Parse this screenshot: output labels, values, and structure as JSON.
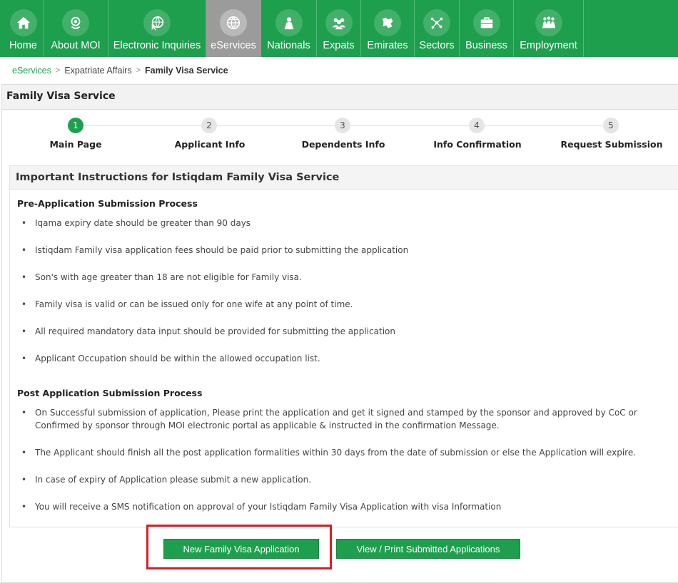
{
  "nav": {
    "items": [
      {
        "label": "Home",
        "icon": "home-icon"
      },
      {
        "label": "About MOI",
        "icon": "emblem-icon"
      },
      {
        "label": "Electronic Inquiries",
        "icon": "globe-cursor-icon"
      },
      {
        "label": "eServices",
        "icon": "globe-icon",
        "active": true
      },
      {
        "label": "Nationals",
        "icon": "person-icon"
      },
      {
        "label": "Expats",
        "icon": "group-icon"
      },
      {
        "label": "Emirates",
        "icon": "map-icon"
      },
      {
        "label": "Sectors",
        "icon": "network-icon"
      },
      {
        "label": "Business",
        "icon": "briefcase-icon"
      },
      {
        "label": "Employment",
        "icon": "handshake-icon"
      }
    ]
  },
  "breadcrumb": {
    "level1": "eServices",
    "level2": "Expatriate Affairs",
    "current": "Family Visa Service"
  },
  "page_title": "Family Visa Service",
  "steps": [
    {
      "num": "1",
      "label": "Main Page",
      "active": true
    },
    {
      "num": "2",
      "label": "Applicant Info"
    },
    {
      "num": "3",
      "label": "Dependents Info"
    },
    {
      "num": "4",
      "label": "Info Confirmation"
    },
    {
      "num": "5",
      "label": "Request Submission"
    }
  ],
  "instructions": {
    "title": "Important Instructions for Istiqdam Family Visa Service",
    "pre_title": "Pre-Application Submission Process",
    "pre_items": [
      "Iqama expiry date should be greater than 90 days",
      "Istiqdam Family visa application fees should be paid prior to submitting the application",
      "Son's with age greater than 18 are not eligible for Family visa.",
      "Family visa is valid or can be issued only for one wife at any point of time.",
      "All required mandatory data input should be provided for submitting the application",
      "Applicant Occupation should be within the allowed occupation list."
    ],
    "post_title": "Post Application Submission Process",
    "post_items": [
      "On Successful submission of application, Please print the application and get it signed and stamped by the sponsor and approved by CoC or Confirmed by sponsor through MOI electronic portal as applicable & instructed in the confirmation Message.",
      "The Applicant should finish all the post application formalities within 30 days from the date of submission or else the Application will expire.",
      "In case of expiry of Application please submit a new application.",
      "You will receive a SMS notification on approval of your Istiqdam Family Visa Application with visa Information"
    ]
  },
  "buttons": {
    "new_application": "New Family Visa Application",
    "view_print": "View / Print Submitted Applications"
  },
  "colors": {
    "brand": "#1e9f4e",
    "highlight": "#e11b22",
    "active_nav": "#9b9b9b"
  }
}
